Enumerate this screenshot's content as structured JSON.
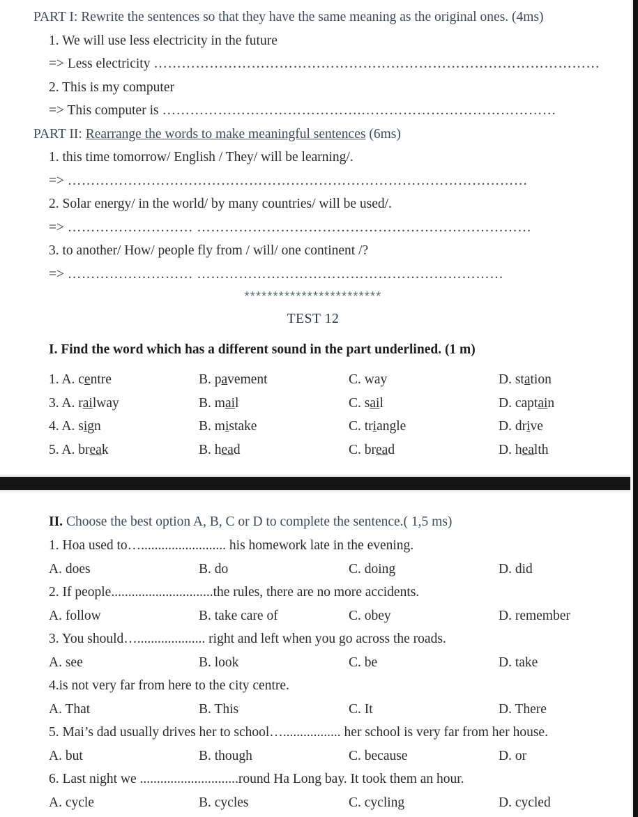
{
  "document": {
    "upper": {
      "part1": {
        "heading": "PART I: Rewrite the sentences so that they have the same meaning as the original ones. (4ms)",
        "items": [
          {
            "prompt": "1. We will use less electricity in the future",
            "answer_lead": "=> Less electricity",
            "dots": "……………………………………………………………………………………"
          },
          {
            "prompt": "2. This is my computer",
            "answer_lead": "=> This computer is",
            "dots": "…………………………………….……………………………………"
          }
        ]
      },
      "part2": {
        "heading_label": "PART II:",
        "heading_underlined": "Rearrange the words to make meaningful sentences",
        "heading_tail": "(6ms)",
        "items": [
          {
            "prompt": "1. this time tomorrow/ English / They/ will be learning/.",
            "answer_lead": "=>",
            "dots": "………………………………………………………………………………………"
          },
          {
            "prompt": "2. Solar energy/ in the world/ by many countries/ will be used/.",
            "answer_lead": "=>",
            "dots": "……………………… ………………………………………………………………"
          },
          {
            "prompt": "3. to another/ How/ people fly from / will/ one continent /?",
            "answer_lead": "=>",
            "dots": "……………………… …………………………………………………………"
          }
        ]
      },
      "divider_stars": "************************",
      "test_title": "TEST 12",
      "part_I_instruction": "I. Find the word which has a different sound in the part underlined. (1 m)",
      "pronunciation_rows": [
        {
          "number": "1.",
          "options": [
            {
              "letter": "A.",
              "pre": "c",
              "underlined": "e",
              "post": "ntre"
            },
            {
              "letter": "B.",
              "pre": "p",
              "underlined": "a",
              "post": "vement"
            },
            {
              "letter": "C.",
              "pre": "way",
              "underlined": "",
              "post": ""
            },
            {
              "letter": "D.",
              "pre": "st",
              "underlined": "a",
              "post": "tion"
            }
          ]
        },
        {
          "number": "3.",
          "options": [
            {
              "letter": "A.",
              "pre": "r",
              "underlined": "ai",
              "post": "lway"
            },
            {
              "letter": "B.",
              "pre": "m",
              "underlined": "ai",
              "post": "l"
            },
            {
              "letter": "C.",
              "pre": "s",
              "underlined": "ai",
              "post": "l"
            },
            {
              "letter": "D.",
              "pre": "capt",
              "underlined": "ai",
              "post": "n"
            }
          ]
        },
        {
          "number": "4.",
          "options": [
            {
              "letter": "A.",
              "pre": "s",
              "underlined": "i",
              "post": "gn"
            },
            {
              "letter": "B.",
              "pre": "m",
              "underlined": "i",
              "post": "stake"
            },
            {
              "letter": "C.",
              "pre": "tr",
              "underlined": "i",
              "post": "angle"
            },
            {
              "letter": "D.",
              "pre": "dr",
              "underlined": "i",
              "post": "ve"
            }
          ]
        },
        {
          "number": "5.",
          "options": [
            {
              "letter": "A.",
              "pre": "br",
              "underlined": "ea",
              "post": "k"
            },
            {
              "letter": "B.",
              "pre": "h",
              "underlined": "ea",
              "post": "d"
            },
            {
              "letter": "C.",
              "pre": "br",
              "underlined": "ea",
              "post": "d"
            },
            {
              "letter": "D.",
              "pre": "h",
              "underlined": "ea",
              "post": "lth"
            }
          ]
        }
      ]
    },
    "lower": {
      "part_II_label": "II.",
      "part_II_instruction": "Choose the best option A, B, C or D to complete the sentence.( 1,5 ms)",
      "questions": [
        {
          "stem": "1. Hoa used to…......................... his homework late in the evening.",
          "options": [
            "A. does",
            "B. do",
            "C. doing",
            "D. did"
          ]
        },
        {
          "stem": "2. If people..............................the rules, there are no more accidents.",
          "options": [
            "A. follow",
            "B. take care of",
            "C. obey",
            "D. remember"
          ]
        },
        {
          "stem": "3. You should….................... right and left when you go across the roads.",
          "options": [
            "A. see",
            "B. look",
            "C. be",
            "D. take"
          ]
        },
        {
          "stem": "4.is not very far from here to the city centre.",
          "options": [
            "A. That",
            "B. This",
            "C. It",
            "D. There"
          ]
        },
        {
          "stem": "5. Mai’s dad usually drives her to school…................. her school is very far from her house.",
          "options": [
            "A. but",
            "B. though",
            "C. because",
            "D. or"
          ]
        },
        {
          "stem": "6. Last night we .............................round Ha Long bay. It took them an hour.",
          "options": [
            "A. cycle",
            "B. cycles",
            "C. cycling",
            "D. cycled"
          ]
        }
      ]
    },
    "colors": {
      "heading_blue": "#3c4a5c",
      "stars_teal": "#4b6b77",
      "page_break_band": "#141414",
      "body_text": "#2b2b2b"
    }
  }
}
